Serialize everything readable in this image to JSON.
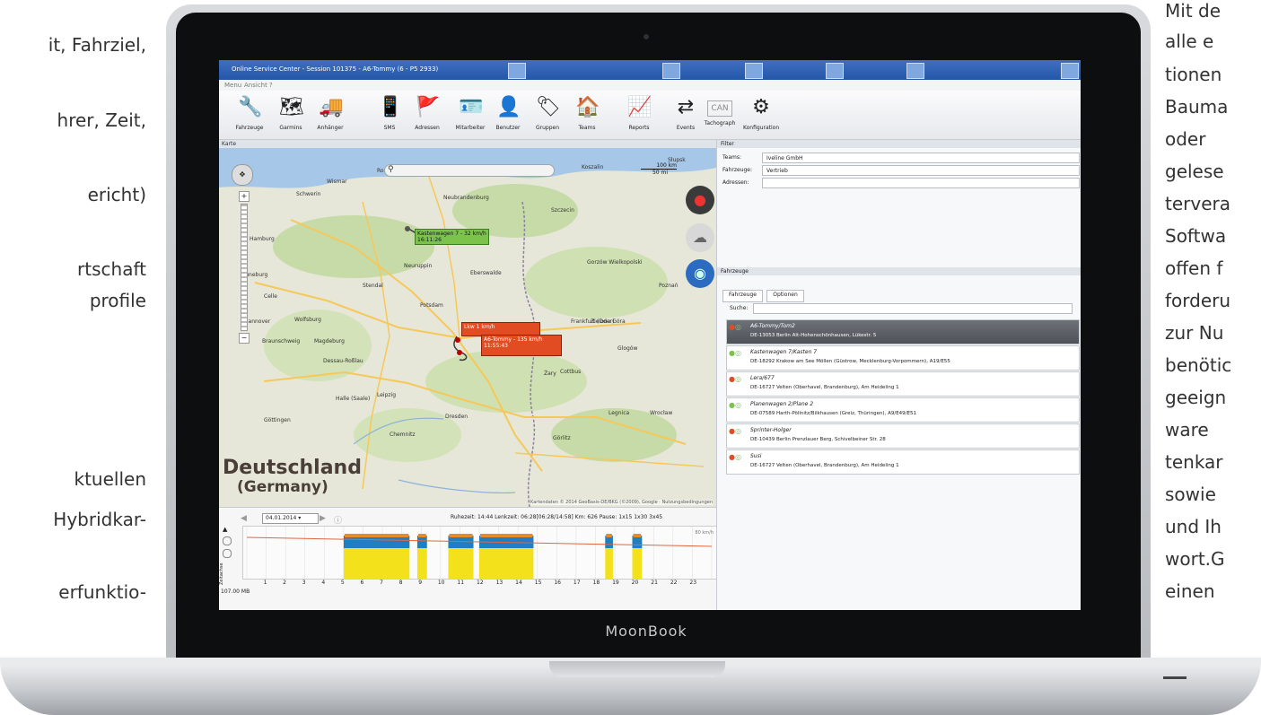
{
  "left_text": [
    "it, Fahrziel,",
    "hrer, Zeit,",
    "ericht)",
    "rtschaft",
    "profile",
    "ktuellen",
    "Hybridkar-",
    "erfunktio-"
  ],
  "right_text": [
    "Mit de",
    "alle e",
    "tionen",
    "Bauma",
    "oder",
    "gelese",
    "tervera",
    "Softwa",
    "offen f",
    "forderu",
    "zur Nu",
    "benötic",
    "geeign",
    "ware",
    "tenkar",
    "sowie",
    "und Ih",
    "wort.G",
    "einen"
  ],
  "laptop_brand": "MoonBook",
  "window": {
    "title": "Online Service Center - Session 101375 - A6-Tommy (6 - P5 2933)",
    "menu": [
      "Menu",
      "Ansicht",
      "?"
    ]
  },
  "toolbar": [
    {
      "label": "Fahrzeuge",
      "icon": "wrench-icon",
      "glyph": "🔧"
    },
    {
      "label": "Garmins",
      "icon": "navigation-device-icon",
      "glyph": "🗺"
    },
    {
      "label": "Anhänger",
      "icon": "trailer-icon",
      "glyph": "🚚"
    },
    {
      "label": "SMS",
      "icon": "phone-icon",
      "glyph": "📱"
    },
    {
      "label": "Adressen",
      "icon": "flag-icon",
      "glyph": "🚩"
    },
    {
      "label": "Mitarbeiter",
      "icon": "id-card-icon",
      "glyph": "🪪"
    },
    {
      "label": "Benutzer",
      "icon": "user-icon",
      "glyph": "👤"
    },
    {
      "label": "Gruppen",
      "icon": "tags-icon",
      "glyph": "🏷"
    },
    {
      "label": "Teams",
      "icon": "house-icon",
      "glyph": "🏠"
    },
    {
      "label": "Reports",
      "icon": "report-icon",
      "glyph": "📈"
    },
    {
      "label": "Events",
      "icon": "arrows-icon",
      "glyph": "⇄"
    },
    {
      "label": "Tachograph",
      "icon": "can-icon",
      "glyph": "CAN"
    },
    {
      "label": "Konfiguration",
      "icon": "gear-icon",
      "glyph": "⚙"
    }
  ],
  "map": {
    "header": "Karte",
    "scale_km": "100 km",
    "scale_mi": "50 mi",
    "country_name": "Deutschland",
    "country_sub": "(Germany)",
    "copyright": "Kartendaten © 2014 GeoBasis-DE/BKG (©2009), Google · Nutzungsbedingungen",
    "cities": [
      "Rostock",
      "Hamburg",
      "Schwerin",
      "Wismar",
      "Neubrandenburg",
      "Szczecin",
      "Gorzów Wielkopolski",
      "Neuruppin",
      "Eberswalde",
      "Stendal",
      "Wolfsburg",
      "Celle",
      "Hannover",
      "Braunschweig",
      "Magdeburg",
      "Potsdam",
      "Frankfurt (Oder)",
      "Poznań",
      "Leipzig",
      "Dresden",
      "Chemnitz",
      "Cottbus",
      "Zielona Góra",
      "Halle (Saale)",
      "Dessau-Roßlau",
      "Göttingen",
      "Legnica",
      "Wrocław",
      "Görlitz",
      "Glogów",
      "Żary",
      "Lüneburg",
      "Koszalin",
      "Słupsk"
    ],
    "labels": [
      {
        "text": "Kastenwagen 7 - 32 km/h",
        "sub": "16:11:26",
        "kind": "green"
      },
      {
        "text": "Lkw 1 km/h",
        "sub": "",
        "kind": "red"
      },
      {
        "text": "A6-Tommy - 135 km/h",
        "sub": "11:55:43",
        "kind": "red"
      }
    ]
  },
  "timeline": {
    "date": "04.01.2014",
    "info": "Ruhezeit: 14:44  Lenkzeit: 06:28[06:28/14:58]  Km: 626  Pause: 1x15 1x30 3x45",
    "ticks": [
      "1",
      "2",
      "3",
      "4",
      "5",
      "6",
      "7",
      "8",
      "9",
      "10",
      "11",
      "12",
      "13",
      "14",
      "15",
      "16",
      "17",
      "18",
      "19",
      "20",
      "21",
      "22",
      "23"
    ],
    "side_label": "Zeitachse",
    "status": "107.00 MB",
    "value_label": "80 km/h"
  },
  "filter": {
    "header": "Filter",
    "rows": [
      {
        "label": "Teams:",
        "value": "Iveline GmbH"
      },
      {
        "label": "Fahrzeuge:",
        "value": "Vertrieb"
      },
      {
        "label": "Adressen:",
        "value": ""
      }
    ]
  },
  "vehicles": {
    "header": "Fahrzeuge",
    "tabs": [
      "Fahrzeuge",
      "Optionen"
    ],
    "search_label": "Suche:",
    "rows": [
      {
        "name": "A6-Tommy/Tom2",
        "address": "DE-13053 Berlin Alt-Hohenschönhausen, Lükestr. 5",
        "status": "red",
        "selected": true
      },
      {
        "name": "Kastenwagen 7/Kasten 7",
        "address": "DE-18292 Krakow am See Möllen (Güstrow, Mecklenburg-Vorpommern), A19/E55",
        "status": "green",
        "selected": false
      },
      {
        "name": "Lera/677",
        "address": "DE-16727 Velten (Oberhavel, Brandenburg), Am Heideling 1",
        "status": "red",
        "selected": false
      },
      {
        "name": "Planenwagen 2/Plane 2",
        "address": "DE-07589 Harth-Pöllnitz/Bilkhausen (Greiz, Thüringen), A9/E49/E51",
        "status": "green",
        "selected": false
      },
      {
        "name": "Sprinter-Holger",
        "address": "DE-10439 Berlin Prenzlauer Berg, Schivelbeiner Str. 28",
        "status": "red",
        "selected": false
      },
      {
        "name": "Susi",
        "address": "DE-16727 Velten (Oberhavel, Brandenburg), Am Heideling 1",
        "status": "red",
        "selected": false
      }
    ]
  },
  "colors": {
    "titlebar": "#2456a8",
    "map_land": "#e4e6d6",
    "forest": "#c6dba7",
    "water": "#a6c7e8",
    "route_green": "#7cc34c",
    "route_red": "#e24c22",
    "chart_yellow": "#f3e21b",
    "chart_blue": "#1e7fc4",
    "speed_line": "#e0663f"
  },
  "timeline_blocks": [
    {
      "start": 5.0,
      "end": 8.4
    },
    {
      "start": 8.8,
      "end": 9.3
    },
    {
      "start": 10.4,
      "end": 11.7
    },
    {
      "start": 12.0,
      "end": 14.8
    },
    {
      "start": 18.5,
      "end": 18.9
    },
    {
      "start": 19.9,
      "end": 20.4
    }
  ]
}
